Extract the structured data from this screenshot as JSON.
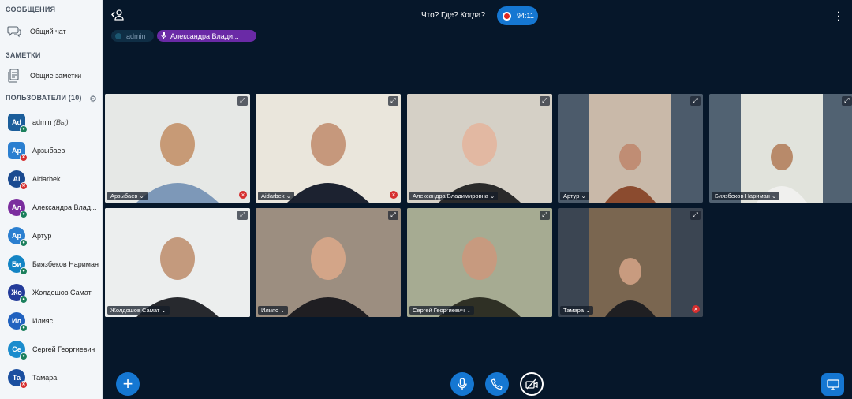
{
  "sidebar": {
    "messages_title": "СООБЩЕНИЯ",
    "public_chat": "Общий чат",
    "notes_title": "ЗАМЕТКИ",
    "shared_notes": "Общие заметки",
    "users_title": "ПОЛЬЗОВАТЕЛИ (10)",
    "users": [
      {
        "initials": "Ad",
        "name": "admin",
        "suffix": "(Вы)",
        "color": "#1b5e9b",
        "status": "on",
        "square": true
      },
      {
        "initials": "Ар",
        "name": "Арзыбаев",
        "suffix": "",
        "color": "#2b7fd0",
        "status": "off",
        "square": true
      },
      {
        "initials": "Ai",
        "name": "Aidarbek",
        "suffix": "",
        "color": "#1a4a90",
        "status": "off",
        "square": false
      },
      {
        "initials": "Ал",
        "name": "Александра Влад...",
        "suffix": "",
        "color": "#7b2d9e",
        "status": "on",
        "square": false
      },
      {
        "initials": "Ар",
        "name": "Артур",
        "suffix": "",
        "color": "#2b7fd0",
        "status": "on",
        "square": false
      },
      {
        "initials": "Би",
        "name": "Биязбеков Нариман",
        "suffix": "",
        "color": "#1384c4",
        "status": "on",
        "square": false
      },
      {
        "initials": "Жо",
        "name": "Жолдошов Самат",
        "suffix": "",
        "color": "#243c9a",
        "status": "on",
        "square": false
      },
      {
        "initials": "Ил",
        "name": "Илияс",
        "suffix": "",
        "color": "#2162bf",
        "status": "on",
        "square": false
      },
      {
        "initials": "Се",
        "name": "Сергей Георгиевич",
        "suffix": "",
        "color": "#1b8ccd",
        "status": "on",
        "square": false
      },
      {
        "initials": "Та",
        "name": "Тамара",
        "suffix": "",
        "color": "#1b4fa0",
        "status": "off",
        "square": false
      }
    ]
  },
  "header": {
    "title": "Что? Где? Когда?",
    "recording_time": "94:11"
  },
  "talking": {
    "admin_label": "admin",
    "alex_label": "Александра Влади..."
  },
  "tiles": [
    {
      "name": "Арзыбаев",
      "muted": true
    },
    {
      "name": "Aidarbek",
      "muted": true
    },
    {
      "name": "Александра Владимировна",
      "muted": false
    },
    {
      "name": "Артур",
      "muted": false
    },
    {
      "name": "Биязбеков Нариман",
      "muted": false
    },
    {
      "name": "Жолдошов Самат",
      "muted": false
    },
    {
      "name": "Илияс",
      "muted": false
    },
    {
      "name": "Сергей Георгиевич",
      "muted": false
    },
    {
      "name": "Тамара",
      "muted": true
    }
  ],
  "colors": {
    "accent": "#1577d2",
    "background": "#06172a",
    "talking_purple": "#6a2aa6",
    "muted_red": "#d62f2f",
    "unmuted_green": "#1b7f5c"
  }
}
